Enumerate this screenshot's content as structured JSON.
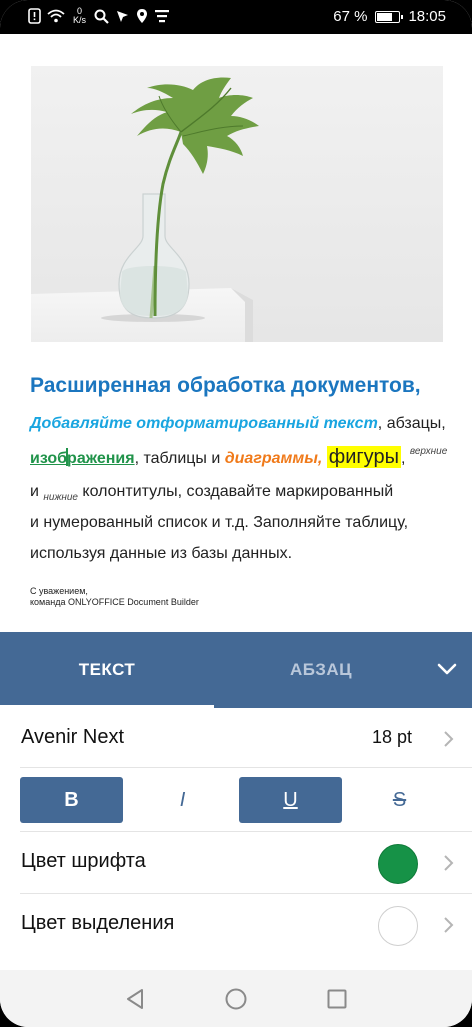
{
  "status_bar": {
    "speed_value": "0",
    "speed_unit": "K/s",
    "battery_percent": "67 %",
    "battery_level": 0.67,
    "time": "18:05",
    "icons": [
      "notification-icon",
      "wifi-icon",
      "search-icon",
      "navigation-icon",
      "location-icon",
      "list-icon"
    ]
  },
  "document": {
    "title": "Расширенная обработка документов,",
    "line1": {
      "formatted": "Добавляйте отформатированный текст",
      "comma": ",  абзацы,"
    },
    "line2": {
      "images_a": "изоб",
      "images_b": "ражения",
      "tables": ", таблицы и ",
      "charts": "диаграммы",
      "comma": ", ",
      "shapes": "фигуры",
      "comma2": ", ",
      "superscript": "верхние"
    },
    "line3": {
      "and": " и ",
      "subscript": "нижние",
      "rest": " колонтитулы, создавайте маркированный"
    },
    "line4": "и нумерованный список и т.д. Заполняйте таблицу,",
    "line5": "используя данные из базы данных.",
    "signature_line1": "С уважением,",
    "signature_line2": "команда ONLYOFFICE Document Builder"
  },
  "tabs": {
    "text_tab": "ТЕКСТ",
    "paragraph_tab": "АБЗАЦ",
    "active": "text"
  },
  "settings": {
    "font_name": "Avenir Next",
    "font_size": "18 pt",
    "bold_label": "B",
    "italic_label": "I",
    "underline_label": "U",
    "strike_label": "S",
    "bold_active": true,
    "italic_active": false,
    "underline_active": true,
    "strike_active": false,
    "font_color_label": "Цвет шрифта",
    "font_color": "#169247",
    "highlight_label": "Цвет выделения",
    "highlight_color": "none"
  },
  "colors": {
    "accent": "#446995",
    "title_blue": "#1b76bf",
    "link_blue": "#19a5e0",
    "green": "#20934a",
    "orange": "#f07a1a",
    "highlight_yellow": "#ffff00"
  }
}
